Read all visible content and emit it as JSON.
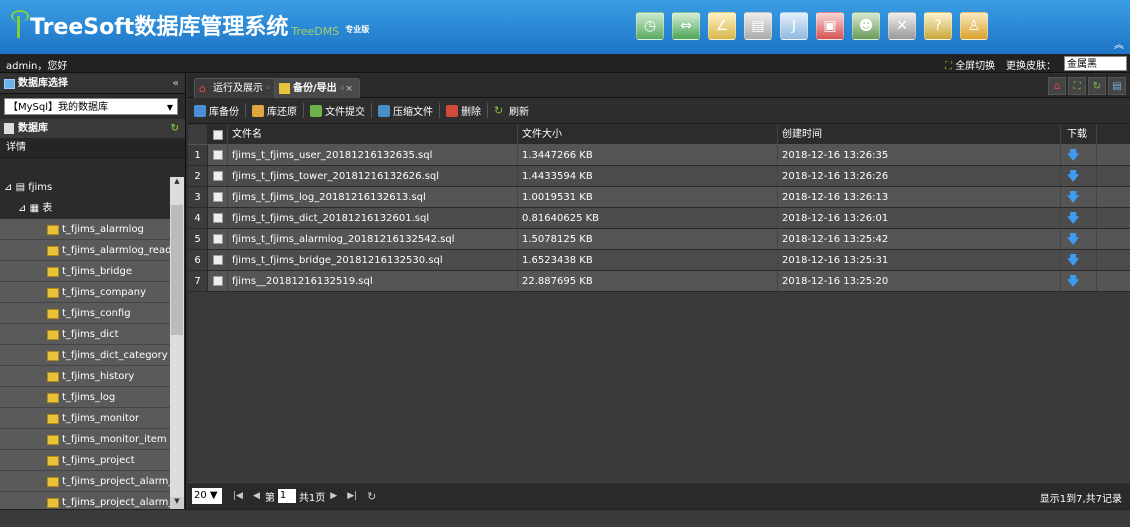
{
  "app": {
    "title": "TreeSoft数据库管理系统",
    "subtitle": "TreeDMS",
    "edition": "专业版"
  },
  "header_icons": [
    "clock-icon",
    "transfer-icon",
    "chart-icon",
    "table-icon",
    "j-icon",
    "log-icon",
    "user-icon",
    "tools-icon",
    "key-icon",
    "person-icon"
  ],
  "userbar": {
    "greeting": "admin，您好",
    "fullscreen": "全屏切换",
    "skin_label": "更换皮肤：",
    "skin_value": "金属黑"
  },
  "left": {
    "panel_title": "数据库选择",
    "collapse": "«",
    "db_select": "【MySql】我的数据库",
    "db_header": "数据库",
    "detail": "详情",
    "tree": {
      "db": "fjims",
      "folder": "表",
      "tables": [
        "t_fjims_alarmlog",
        "t_fjims_alarmlog_read",
        "t_fjims_bridge",
        "t_fjims_company",
        "t_fjims_config",
        "t_fjims_dict",
        "t_fjims_dict_category",
        "t_fjims_history",
        "t_fjims_log",
        "t_fjims_monitor",
        "t_fjims_monitor_item",
        "t_fjims_project",
        "t_fjims_project_alarm_",
        "t_fjims_project_alarm_"
      ]
    }
  },
  "tabs": [
    {
      "label": "运行及展示"
    },
    {
      "label": "备份/导出"
    }
  ],
  "toolbar": {
    "backup": "库备份",
    "restore": "库还原",
    "submit": "文件提交",
    "compress": "压缩文件",
    "delete": "删除",
    "refresh": "刷新"
  },
  "grid": {
    "headers": {
      "name": "文件名",
      "size": "文件大小",
      "time": "创建时间",
      "download": "下载"
    },
    "rows": [
      {
        "num": "1",
        "name": "fjims_t_fjims_user_20181216132635.sql",
        "size": "1.3447266 KB",
        "time": "2018-12-16 13:26:35"
      },
      {
        "num": "2",
        "name": "fjims_t_fjims_tower_20181216132626.sql",
        "size": "1.4433594 KB",
        "time": "2018-12-16 13:26:26"
      },
      {
        "num": "3",
        "name": "fjims_t_fjims_log_20181216132613.sql",
        "size": "1.0019531 KB",
        "time": "2018-12-16 13:26:13"
      },
      {
        "num": "4",
        "name": "fjims_t_fjims_dict_20181216132601.sql",
        "size": "0.81640625 KB",
        "time": "2018-12-16 13:26:01"
      },
      {
        "num": "5",
        "name": "fjims_t_fjims_alarmlog_20181216132542.sql",
        "size": "1.5078125 KB",
        "time": "2018-12-16 13:25:42"
      },
      {
        "num": "6",
        "name": "fjims_t_fjims_bridge_20181216132530.sql",
        "size": "1.6523438 KB",
        "time": "2018-12-16 13:25:31"
      },
      {
        "num": "7",
        "name": "fjims__20181216132519.sql",
        "size": "22.887695 KB",
        "time": "2018-12-16 13:25:20"
      }
    ]
  },
  "pager": {
    "page_size": "20",
    "page_prefix": "第",
    "page": "1",
    "page_total": "共1页",
    "info": "显示1到7,共7记录"
  }
}
